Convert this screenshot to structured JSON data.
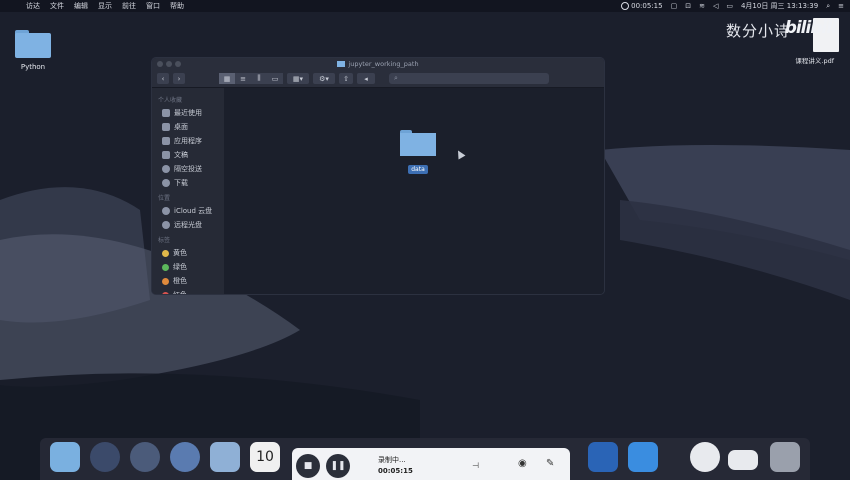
{
  "menubar": {
    "apple": "",
    "items": [
      "访达",
      "文件",
      "编辑",
      "显示",
      "前往",
      "窗口",
      "帮助"
    ],
    "recording_time": "00:05:15",
    "datetime": "4月10日 周三  13:13:39"
  },
  "desktop": {
    "folder_label": "Python",
    "brand_text": "数分小诗",
    "brand_logo": "bilibili",
    "pdf_label": "课程讲义.pdf"
  },
  "finder": {
    "title": "jupyter_working_path",
    "sections": {
      "favorites": "个人收藏",
      "icloud": "位置",
      "tags": "标签"
    },
    "favorites": [
      "最近使用",
      "桌面",
      "应用程序",
      "文稿",
      "隔空投送",
      "下载"
    ],
    "locations": [
      "iCloud 云盘",
      "远程光盘"
    ],
    "tags": [
      {
        "label": "黄色",
        "color": "#e0b84a"
      },
      {
        "label": "绿色",
        "color": "#5cb85c"
      },
      {
        "label": "橙色",
        "color": "#e08a3c"
      },
      {
        "label": "红色",
        "color": "#d9534f"
      }
    ],
    "content_folder_label": "data"
  },
  "recorder": {
    "status": "录制中...",
    "time": "00:05:15"
  }
}
